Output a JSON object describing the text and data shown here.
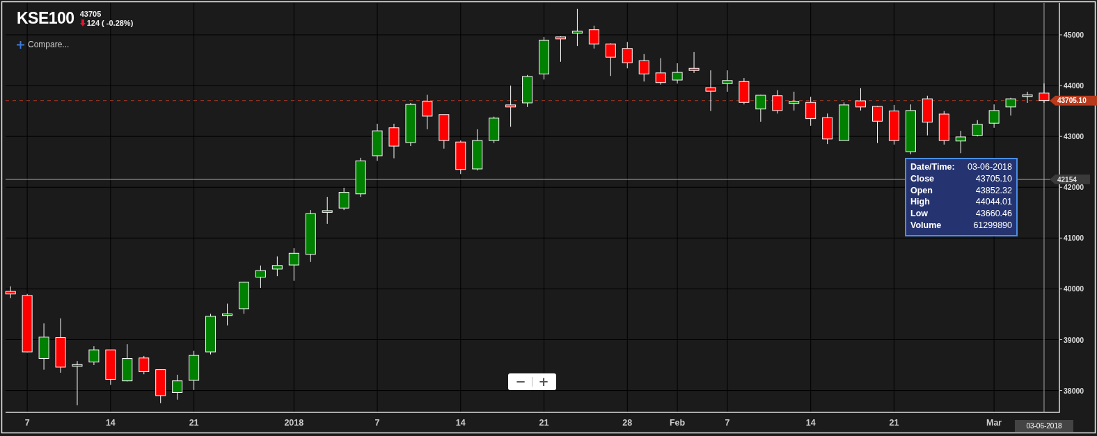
{
  "header": {
    "symbol": "KSE100",
    "last": "43705",
    "falling": true,
    "change": "124 ( -0.28%)"
  },
  "compare_button": {
    "label": "Compare..."
  },
  "chart": {
    "chart_data": {
      "type": "candlestick",
      "grid": true,
      "ylim": [
        37570,
        45630
      ],
      "yticks": [
        38000,
        39000,
        40000,
        41000,
        42000,
        43000,
        44000,
        45000
      ],
      "categories": [
        null,
        "7",
        null,
        null,
        null,
        null,
        "14",
        null,
        null,
        null,
        null,
        "21",
        null,
        null,
        null,
        null,
        null,
        "2018",
        null,
        null,
        null,
        null,
        "7",
        null,
        null,
        null,
        null,
        "14",
        null,
        null,
        null,
        null,
        "21",
        null,
        null,
        null,
        null,
        "28",
        null,
        null,
        "Feb",
        null,
        null,
        "7",
        null,
        null,
        null,
        null,
        "14",
        null,
        null,
        null,
        null,
        "21",
        null,
        null,
        null,
        null,
        null,
        "Mar",
        null,
        null,
        null
      ],
      "ohlc": [
        [
          39950,
          40050,
          39820,
          39900
        ],
        [
          39870,
          39900,
          38750,
          38760
        ],
        [
          38630,
          39320,
          38410,
          39050
        ],
        [
          39040,
          39420,
          38350,
          38460
        ],
        [
          38500,
          38580,
          37710,
          38510
        ],
        [
          38560,
          38870,
          38500,
          38800
        ],
        [
          38800,
          38800,
          38110,
          38220
        ],
        [
          38190,
          38910,
          38180,
          38630
        ],
        [
          38640,
          38680,
          38320,
          38370
        ],
        [
          38410,
          38410,
          37750,
          37900
        ],
        [
          37960,
          38310,
          37820,
          38190
        ],
        [
          38200,
          38780,
          38010,
          38690
        ],
        [
          38760,
          39510,
          38710,
          39460
        ],
        [
          39490,
          39710,
          39280,
          39510
        ],
        [
          39610,
          40140,
          39510,
          40130
        ],
        [
          40230,
          40460,
          40020,
          40360
        ],
        [
          40390,
          40640,
          40250,
          40460
        ],
        [
          40470,
          40800,
          40160,
          40700
        ],
        [
          40680,
          41550,
          40530,
          41480
        ],
        [
          41510,
          41810,
          41280,
          41540
        ],
        [
          41590,
          41990,
          41550,
          41900
        ],
        [
          41870,
          42580,
          41810,
          42520
        ],
        [
          42620,
          43250,
          42520,
          43110
        ],
        [
          43170,
          43250,
          42570,
          42810
        ],
        [
          42880,
          43660,
          42810,
          43630
        ],
        [
          43690,
          43820,
          43140,
          43400
        ],
        [
          43430,
          43430,
          42760,
          42920
        ],
        [
          42890,
          42920,
          42260,
          42350
        ],
        [
          42360,
          43140,
          42330,
          42920
        ],
        [
          42920,
          43390,
          42870,
          43360
        ],
        [
          43620,
          44000,
          43190,
          43580
        ],
        [
          43660,
          44210,
          43580,
          44180
        ],
        [
          44230,
          44960,
          44120,
          44890
        ],
        [
          44960,
          44970,
          44470,
          44920
        ],
        [
          45030,
          45510,
          44780,
          45070
        ],
        [
          45100,
          45180,
          44730,
          44820
        ],
        [
          44820,
          44830,
          44190,
          44560
        ],
        [
          44730,
          44860,
          44340,
          44450
        ],
        [
          44490,
          44620,
          44080,
          44230
        ],
        [
          44250,
          44540,
          44020,
          44060
        ],
        [
          44110,
          44440,
          44040,
          44260
        ],
        [
          44340,
          44660,
          44250,
          44300
        ],
        [
          43960,
          44300,
          43500,
          43890
        ],
        [
          44040,
          44300,
          43880,
          44100
        ],
        [
          44080,
          44150,
          43630,
          43670
        ],
        [
          43540,
          43820,
          43290,
          43810
        ],
        [
          43800,
          43910,
          43450,
          43510
        ],
        [
          43650,
          43880,
          43510,
          43690
        ],
        [
          43670,
          43780,
          43210,
          43350
        ],
        [
          43370,
          43450,
          42850,
          42950
        ],
        [
          42920,
          43670,
          42920,
          43620
        ],
        [
          43700,
          43950,
          43510,
          43580
        ],
        [
          43590,
          43600,
          42870,
          43300
        ],
        [
          43500,
          43620,
          42840,
          42920
        ],
        [
          42700,
          43630,
          42650,
          43510
        ],
        [
          43740,
          43800,
          43020,
          43280
        ],
        [
          43440,
          43500,
          42840,
          42920
        ],
        [
          42910,
          43110,
          42670,
          42990
        ],
        [
          43020,
          43320,
          43000,
          43240
        ],
        [
          43260,
          43630,
          43170,
          43510
        ],
        [
          43580,
          43760,
          43410,
          43740
        ],
        [
          43800,
          43880,
          43660,
          43820
        ],
        [
          43852.32,
          44044.01,
          43660.46,
          43705.1
        ]
      ],
      "ref_lines": [
        {
          "axis": "y",
          "value": 43705.1,
          "label": "43705.10"
        },
        {
          "axis": "y",
          "value": 42154,
          "label": "42154"
        }
      ]
    },
    "crosshair_date_tag": "03-06-2018",
    "tooltip": {
      "rows": [
        {
          "label": "Date/Time:",
          "value": "03-06-2018"
        },
        {
          "label": "Close",
          "value": "43705.10"
        },
        {
          "label": "Open",
          "value": "43852.32"
        },
        {
          "label": "High",
          "value": "44044.01"
        },
        {
          "label": "Low",
          "value": "43660.46"
        },
        {
          "label": "Volume",
          "value": "61299890"
        }
      ]
    }
  },
  "zoom_controls": [
    "−",
    "+"
  ]
}
